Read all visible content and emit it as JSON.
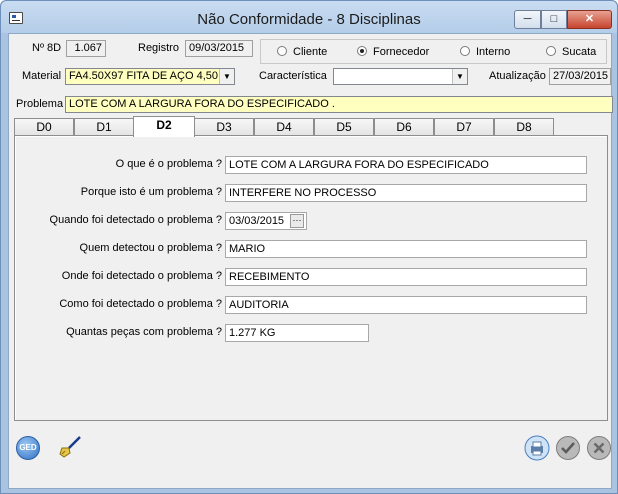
{
  "window": {
    "title": "Não Conformidade - 8 Disciplinas",
    "min_glyph": "─",
    "max_glyph": "□",
    "close_glyph": "✕"
  },
  "header": {
    "n8d_label": "Nº 8D",
    "n8d_value": "1.067",
    "registro_label": "Registro",
    "registro_value": "09/03/2015",
    "material_label": "Material",
    "material_value": "FA4.50X97  FITA DE AÇO 4,50",
    "caracteristica_label": "Característica",
    "caracteristica_value": "",
    "atualizacao_label": "Atualização",
    "atualizacao_value": "27/03/2015",
    "problema_label": "Problema",
    "problema_value": "LOTE COM A LARGURA FORA DO ESPECIFICADO  ."
  },
  "origin": {
    "options": [
      "Cliente",
      "Fornecedor",
      "Interno",
      "Sucata"
    ],
    "selected": "Fornecedor"
  },
  "tabs": [
    "D0",
    "D1",
    "D2",
    "D3",
    "D4",
    "D5",
    "D6",
    "D7",
    "D8"
  ],
  "active_tab": "D2",
  "d2": {
    "q1": "O que é o problema ?",
    "a1": "LOTE COM A LARGURA FORA DO ESPECIFICADO",
    "q2": "Porque isto é um problema ?",
    "a2": "INTERFERE NO PROCESSO",
    "q3": "Quando foi detectado o problema ?",
    "a3": "03/03/2015",
    "a3_button": "···",
    "q4": "Quem detectou o problema ?",
    "a4": "MARIO",
    "q5": "Onde foi detectado o problema ?",
    "a5": "RECEBIMENTO",
    "q6": "Como foi detectado o problema ?",
    "a6": "AUDITORIA",
    "q7": "Quantas peças com problema ?",
    "a7": "1.277 KG"
  },
  "footer": {
    "ged_label": "GED"
  },
  "colors": {
    "yellow_field": "#ffffc0",
    "title_bar": "#b4cde9",
    "close_button": "#c8452f"
  }
}
